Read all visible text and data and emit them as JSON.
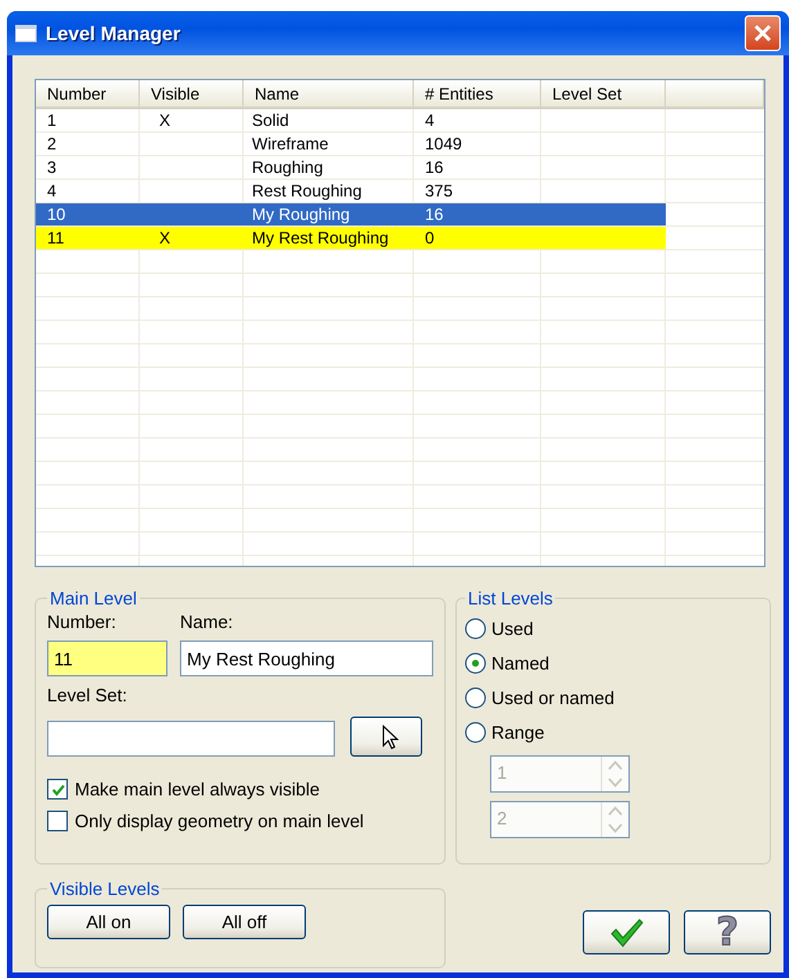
{
  "window": {
    "title": "Level Manager"
  },
  "table": {
    "columns": [
      "Number",
      "Visible",
      "Name",
      "# Entities",
      "Level Set"
    ],
    "rows": [
      {
        "number": "1",
        "visible": "X",
        "name": "Solid",
        "entities": "4",
        "selected": false,
        "current": false
      },
      {
        "number": "2",
        "name": "Wireframe",
        "entities": "1049",
        "selected": false,
        "current": false
      },
      {
        "number": "3",
        "name": "Roughing",
        "entities": "16",
        "selected": false,
        "current": false
      },
      {
        "number": "4",
        "name": "Rest Roughing",
        "entities": "375",
        "selected": false,
        "current": false
      },
      {
        "number": "10",
        "name": "My Roughing",
        "entities": "16",
        "selected": true,
        "current": false
      },
      {
        "number": "11",
        "visible": "X",
        "name": "My Rest Roughing",
        "entities": "0",
        "selected": false,
        "current": true
      }
    ]
  },
  "main_level": {
    "legend": "Main Level",
    "number_label": "Number:",
    "number": "11",
    "name_label": "Name:",
    "name": "My Rest Roughing",
    "level_set_label": "Level Set:",
    "options": [
      {
        "label": "Make main level always visible",
        "checked": true
      },
      {
        "label": "Only display geometry on main level",
        "checked": false
      }
    ]
  },
  "list_levels": {
    "legend": "List Levels",
    "options": [
      {
        "label": "Used",
        "selected": false
      },
      {
        "label": "Named",
        "selected": true
      },
      {
        "label": "Used or named",
        "selected": false
      },
      {
        "label": "Range",
        "selected": false
      }
    ],
    "range": [
      {
        "value": "1",
        "disabled": true
      },
      {
        "value": "2",
        "disabled": true
      }
    ]
  },
  "visible_levels": {
    "legend": "Visible Levels",
    "buttons": [
      "All on",
      "All off"
    ]
  },
  "actions": {
    "help": "?"
  }
}
